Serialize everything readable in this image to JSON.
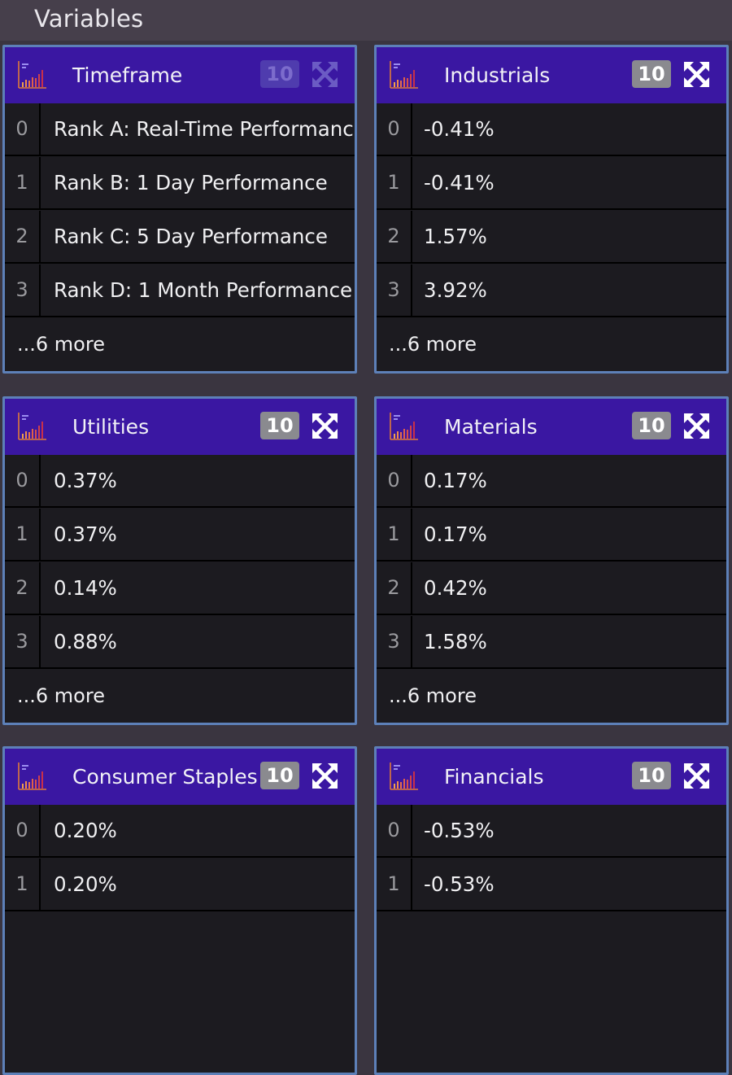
{
  "header": {
    "title": "Variables"
  },
  "cards": [
    {
      "title": "Timeframe",
      "count": "10",
      "rows": [
        {
          "index": "0",
          "value": "Rank A: Real-Time Performance"
        },
        {
          "index": "1",
          "value": "Rank B: 1 Day Performance"
        },
        {
          "index": "2",
          "value": "Rank C: 5 Day Performance"
        },
        {
          "index": "3",
          "value": "Rank D: 1 Month Performance"
        }
      ],
      "more": "...6 more"
    },
    {
      "title": "Industrials",
      "count": "10",
      "rows": [
        {
          "index": "0",
          "value": "-0.41%"
        },
        {
          "index": "1",
          "value": "-0.41%"
        },
        {
          "index": "2",
          "value": "1.57%"
        },
        {
          "index": "3",
          "value": "3.92%"
        }
      ],
      "more": "...6 more"
    },
    {
      "title": "Utilities",
      "count": "10",
      "rows": [
        {
          "index": "0",
          "value": "0.37%"
        },
        {
          "index": "1",
          "value": "0.37%"
        },
        {
          "index": "2",
          "value": "0.14%"
        },
        {
          "index": "3",
          "value": "0.88%"
        }
      ],
      "more": "...6 more"
    },
    {
      "title": "Materials",
      "count": "10",
      "rows": [
        {
          "index": "0",
          "value": "0.17%"
        },
        {
          "index": "1",
          "value": "0.17%"
        },
        {
          "index": "2",
          "value": "0.42%"
        },
        {
          "index": "3",
          "value": "1.58%"
        }
      ],
      "more": "...6 more"
    },
    {
      "title": "Consumer Staples",
      "count": "10",
      "rows": [
        {
          "index": "0",
          "value": "0.20%"
        },
        {
          "index": "1",
          "value": "0.20%"
        }
      ],
      "more": ""
    },
    {
      "title": "Financials",
      "count": "10",
      "rows": [
        {
          "index": "0",
          "value": "-0.53%"
        },
        {
          "index": "1",
          "value": "-0.53%"
        }
      ],
      "more": ""
    }
  ],
  "icons": {
    "card_icon": "bar-chart-icon",
    "expand": "expand-arrows-icon"
  },
  "colors": {
    "header": "#3a17a2",
    "border": "#5d80b8",
    "background": "#1c1b20",
    "badge": "#8a8a8f"
  }
}
